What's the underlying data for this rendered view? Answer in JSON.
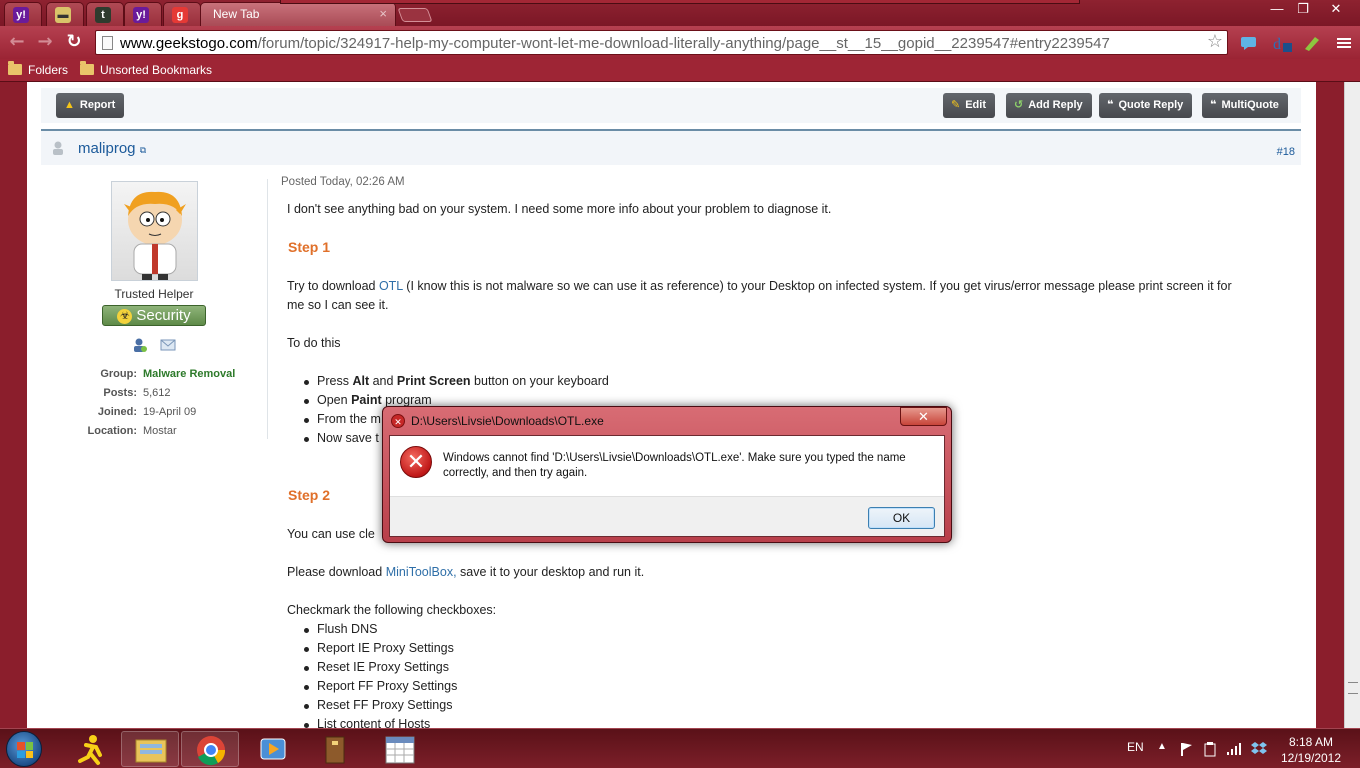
{
  "browser": {
    "tabs": [
      {
        "fav": "y!",
        "color": "#6a1b9a"
      },
      {
        "fav": "▬",
        "color": "#d9c36a"
      },
      {
        "fav": "t",
        "color": "#2e3b2e"
      },
      {
        "fav": "y!",
        "color": "#6a1b9a"
      },
      {
        "fav": "g",
        "color": "#e53935"
      }
    ],
    "active_tab_title": "New Tab",
    "active_tab_close": "×",
    "window_controls": [
      "—",
      "❐",
      "✕"
    ],
    "nav": {
      "back": "←",
      "forward": "→",
      "reload": "↻"
    },
    "url_host": "www.geekstogo.com",
    "url_path": "/forum/topic/324917-help-my-computer-wont-let-me-download-literally-anything/page__st__15__gopid__2239547#entry2239547",
    "star": "☆",
    "bookmarks": [
      {
        "label": "Folders"
      },
      {
        "label": "Unsorted Bookmarks"
      }
    ]
  },
  "forum": {
    "report_button": "Report",
    "edit_button": "Edit",
    "add_reply_button": "Add Reply",
    "quote_reply_button": "Quote Reply",
    "multiquote_button": "MultiQuote",
    "author": "maliprog",
    "post_number": "#18",
    "rank": "Trusted Helper",
    "badge": "Security",
    "profile": [
      {
        "k": "Group:",
        "v": "Malware Removal"
      },
      {
        "k": "Posts:",
        "v": "5,612"
      },
      {
        "k": "Joined:",
        "v": "19-April 09"
      },
      {
        "k": "Location:",
        "v": "Mostar"
      }
    ],
    "posted": "Posted Today, 02:26 AM",
    "intro": "I don't see anything bad on your system. I need some more info about your problem to diagnose it.",
    "step1": "Step 1",
    "step1_text_a": "Try to download ",
    "step1_link": "OTL",
    "step1_text_b": " (I know this is not malware so we can use it as reference) to your Desktop on infected system. If you get virus/error message please print screen it for",
    "step1_text_c": "me so I can see it.",
    "todo": "To do this",
    "b1_a": "Press ",
    "b1_b": "Alt",
    "b1_c": " and ",
    "b1_d": "Print Screen",
    "b1_e": " button on your keyboard",
    "b2_a": "Open ",
    "b2_b": "Paint",
    "b2_c": " program",
    "b3": "From the m",
    "b4": "Now save t",
    "step2": "Step 2",
    "step2_text": "You can use cle",
    "download_a": "Please download ",
    "download_link": "MiniToolBox,",
    "download_b": " save it to your desktop and run it.",
    "checkmark": "Checkmark the following checkboxes:",
    "checklist": [
      "Flush DNS",
      "Report IE Proxy Settings",
      "Reset IE Proxy Settings",
      "Report FF Proxy Settings",
      "Reset FF Proxy Settings",
      "List content of Hosts"
    ]
  },
  "dialog": {
    "title": "D:\\Users\\Livsie\\Downloads\\OTL.exe",
    "message": "Windows cannot find 'D:\\Users\\Livsie\\Downloads\\OTL.exe'. Make sure you typed the name correctly, and then try again.",
    "ok": "OK",
    "close": "✕"
  },
  "taskbar": {
    "lang": "EN",
    "time": "8:18 AM",
    "date": "12/19/2012"
  }
}
